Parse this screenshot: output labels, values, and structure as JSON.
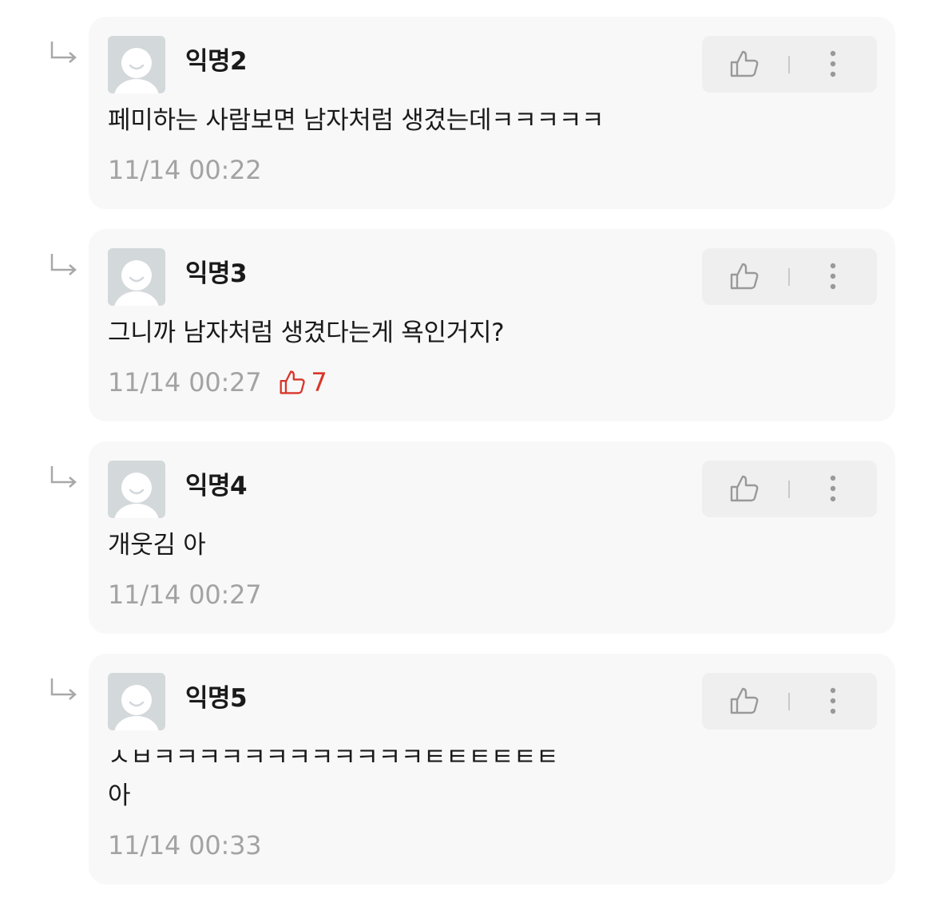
{
  "comments": [
    {
      "author": "익명2",
      "text": "페미하는 사람보면 남자처럼 생겼는데ㅋㅋㅋㅋㅋ",
      "timestamp": "11/14 00:22",
      "likes": ""
    },
    {
      "author": "익명3",
      "text": "그니까 남자처럼 생겼다는게 욕인거지?",
      "timestamp": "11/14 00:27",
      "likes": "7"
    },
    {
      "author": "익명4",
      "text": "개웃김 아",
      "timestamp": "11/14 00:27",
      "likes": ""
    },
    {
      "author": "익명5",
      "text": "ㅅㅂㅋㅋㅋㅋㅋㅋㅋㅋㅋㅋㅋㅋㅌㅌㅌㅌㅌㅌ\n아",
      "timestamp": "11/14 00:33",
      "likes": ""
    }
  ],
  "icons": {
    "reply": "reply-arrow-icon",
    "avatar": "anonymous-avatar-icon",
    "like": "thumbs-up-icon",
    "more": "vertical-ellipsis-icon"
  },
  "colors": {
    "card_bg": "#f8f8f8",
    "action_bg": "#efefef",
    "like_red": "#d9362b",
    "muted_text": "#a3a3a3",
    "avatar_bg": "#d3d8db"
  }
}
